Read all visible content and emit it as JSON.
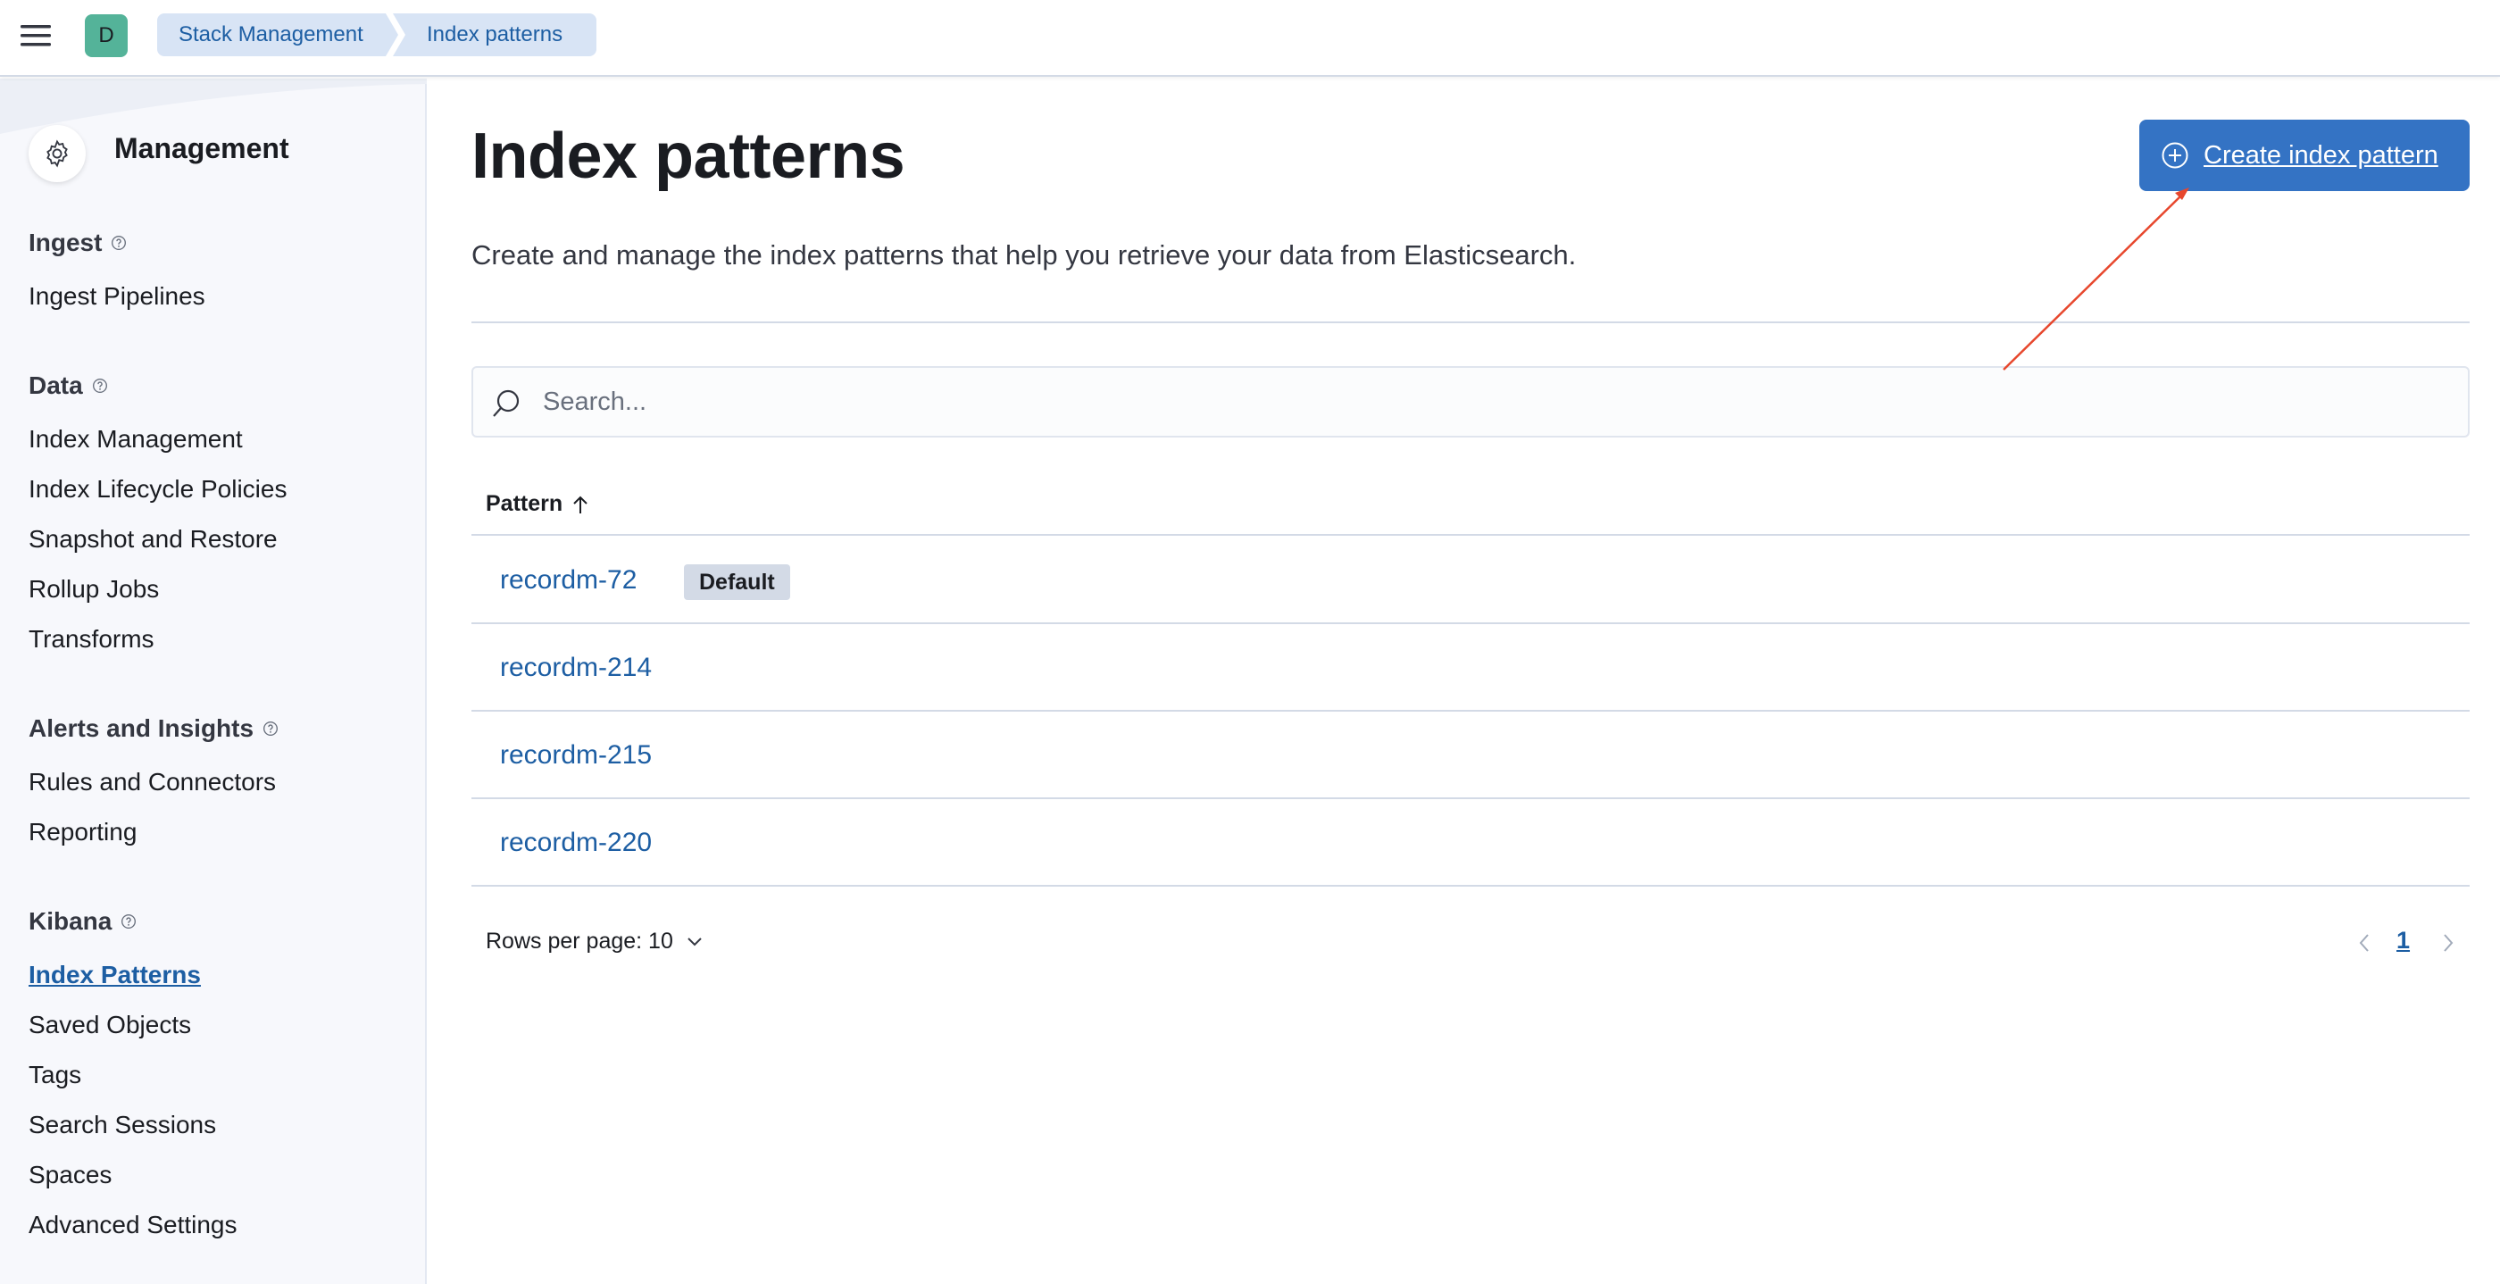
{
  "header": {
    "avatar_initial": "D",
    "breadcrumbs": [
      "Stack Management",
      "Index patterns"
    ]
  },
  "sidebar": {
    "title": "Management",
    "sections": [
      {
        "title": "Ingest",
        "items": [
          "Ingest Pipelines"
        ]
      },
      {
        "title": "Data",
        "items": [
          "Index Management",
          "Index Lifecycle Policies",
          "Snapshot and Restore",
          "Rollup Jobs",
          "Transforms"
        ]
      },
      {
        "title": "Alerts and Insights",
        "items": [
          "Rules and Connectors",
          "Reporting"
        ]
      },
      {
        "title": "Kibana",
        "items": [
          "Index Patterns",
          "Saved Objects",
          "Tags",
          "Search Sessions",
          "Spaces",
          "Advanced Settings"
        ]
      }
    ],
    "active_item": "Index Patterns"
  },
  "main": {
    "title": "Index patterns",
    "description": "Create and manage the index patterns that help you retrieve your data from Elasticsearch.",
    "create_button_label": "Create index pattern",
    "search_placeholder": "Search...",
    "table": {
      "column_header": "Pattern",
      "rows": [
        {
          "pattern": "recordm-72",
          "badge": "Default"
        },
        {
          "pattern": "recordm-214"
        },
        {
          "pattern": "recordm-215"
        },
        {
          "pattern": "recordm-220"
        }
      ]
    },
    "pagination": {
      "rows_per_page_label": "Rows per page: 10",
      "current_page": "1"
    }
  },
  "colors": {
    "primary": "#3473c4",
    "link": "#1d5ea3",
    "breadcrumb_bg": "#d8e4f5",
    "avatar_bg": "#54b399",
    "annotation_arrow": "#e7472d"
  }
}
